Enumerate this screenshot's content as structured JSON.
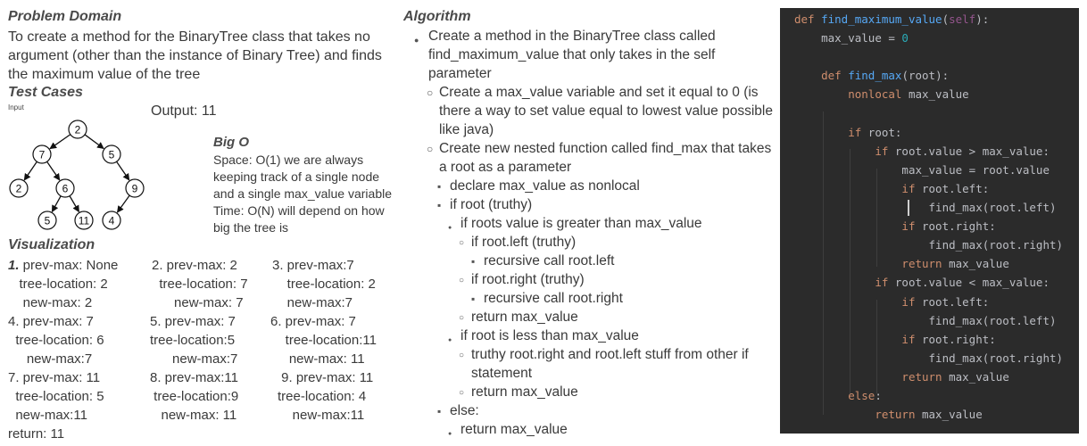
{
  "problem_domain": {
    "heading": "Problem Domain",
    "text": "To create a method for the BinaryTree class that takes no argument (other than the instance of Binary Tree) and finds the maximum value of the tree"
  },
  "test_cases": {
    "heading": "Test Cases",
    "input_label": "Input",
    "output": "Output: 11",
    "tree_nodes": [
      "2",
      "7",
      "5",
      "2",
      "6",
      "9",
      "5",
      "11",
      "4"
    ]
  },
  "big_o": {
    "heading": "Big O",
    "lines": [
      "Space: O(1) we are always",
      "keeping track of a single node",
      "and a single max_value variable",
      "Time: O(N) will depend on how",
      "big the tree is"
    ]
  },
  "visualization": {
    "heading": "Visualization",
    "steps": [
      {
        "num": "1.",
        "a": " prev-max: None",
        "b": "   tree-location: 2",
        "c": "    new-max: 2"
      },
      {
        "a": "2. prev-max: 2",
        "b": "  tree-location: 7",
        "c": "      new-max: 7"
      },
      {
        "a": "3. prev-max:7",
        "b": "    tree-location: 2",
        "c": "    new-max:7"
      },
      {
        "a": "4. prev-max: 7",
        "b": "  tree-location: 6",
        "c": "     new-max:7"
      },
      {
        "a": "5. prev-max: 7",
        "b": "tree-location:5",
        "c": "      new-max:7"
      },
      {
        "a": "6. prev-max: 7",
        "b": "    tree-location:11",
        "c": "     new-max: 11"
      },
      {
        "a": "7. prev-max: 11",
        "b": "  tree-location: 5",
        "c": "  new-max:11"
      },
      {
        "a": "8. prev-max:11",
        "b": " tree-location:9",
        "c": "   new-max: 11"
      },
      {
        "a": " 9. prev-max: 11",
        "b": "tree-location: 4",
        "c": "    new-max:11"
      }
    ],
    "return": "return: 11"
  },
  "algorithm": {
    "heading": "Algorithm",
    "items": [
      "Create a method in the BinaryTree class called find_maximum_value that only takes in the self parameter",
      "Create a max_value variable and set it equal to 0 (is there a way to set value equal to lowest value possible like java)",
      "Create new nested function called find_max that takes a root as a parameter",
      "declare max_value as nonlocal",
      "if root (truthy)",
      "if roots value is greater than max_value",
      "if root.left (truthy)",
      "recursive call root.left",
      "if root.right (truthy)",
      "recursive call root.right",
      "return max_value",
      "if root is less than max_value",
      "truthy root.right and root.left stuff from other if statement",
      "return max_value",
      "else:",
      "return max_value"
    ]
  },
  "code": {
    "colors": {
      "background": "#2b2b2b",
      "keyword": "#cf8e6d",
      "function": "#56a8f5",
      "self": "#94558d",
      "number": "#2aacb8",
      "text": "#bcbec4"
    },
    "lines": [
      {
        "indent": "",
        "parts": [
          [
            "kw",
            "def "
          ],
          [
            "fn",
            "find_maximum_value"
          ],
          [
            "",
            "("
          ],
          [
            "slf",
            "self"
          ],
          [
            "",
            "):"
          ]
        ]
      },
      {
        "indent": "    ",
        "parts": [
          [
            "",
            "max_value = "
          ],
          [
            "num",
            "0"
          ]
        ]
      },
      {
        "indent": "",
        "parts": []
      },
      {
        "indent": "    ",
        "parts": [
          [
            "kw",
            "def "
          ],
          [
            "fn",
            "find_max"
          ],
          [
            "",
            "(root):"
          ]
        ]
      },
      {
        "indent": "        ",
        "parts": [
          [
            "kw",
            "nonlocal "
          ],
          [
            "",
            "max_value"
          ]
        ]
      },
      {
        "indent": "",
        "parts": []
      },
      {
        "indent": "        ",
        "parts": [
          [
            "kw",
            "if "
          ],
          [
            "",
            "root:"
          ]
        ]
      },
      {
        "indent": "            ",
        "parts": [
          [
            "kw",
            "if "
          ],
          [
            "",
            "root.value > max_value:"
          ]
        ]
      },
      {
        "indent": "                ",
        "parts": [
          [
            "",
            "max_value = root.value"
          ]
        ]
      },
      {
        "indent": "                ",
        "parts": [
          [
            "kw",
            "if "
          ],
          [
            "",
            "root.left:"
          ]
        ]
      },
      {
        "indent": "                    ",
        "parts": [
          [
            "",
            "find_max(root.left)"
          ]
        ]
      },
      {
        "indent": "                ",
        "parts": [
          [
            "kw",
            "if "
          ],
          [
            "",
            "root.right:"
          ]
        ]
      },
      {
        "indent": "                    ",
        "parts": [
          [
            "",
            "find_max(root.right)"
          ]
        ]
      },
      {
        "indent": "                ",
        "parts": [
          [
            "kw",
            "return "
          ],
          [
            "",
            "max_value"
          ]
        ]
      },
      {
        "indent": "            ",
        "parts": [
          [
            "kw",
            "if "
          ],
          [
            "",
            "root.value < max_value:"
          ]
        ]
      },
      {
        "indent": "                ",
        "parts": [
          [
            "kw",
            "if "
          ],
          [
            "",
            "root.left:"
          ]
        ]
      },
      {
        "indent": "                    ",
        "parts": [
          [
            "",
            "find_max(root.left)"
          ]
        ]
      },
      {
        "indent": "                ",
        "parts": [
          [
            "kw",
            "if "
          ],
          [
            "",
            "root.right:"
          ]
        ]
      },
      {
        "indent": "                    ",
        "parts": [
          [
            "",
            "find_max(root.right)"
          ]
        ]
      },
      {
        "indent": "                ",
        "parts": [
          [
            "kw",
            "return "
          ],
          [
            "",
            "max_value"
          ]
        ]
      },
      {
        "indent": "        ",
        "parts": [
          [
            "kw",
            "else"
          ],
          [
            "",
            ":"
          ]
        ]
      },
      {
        "indent": "            ",
        "parts": [
          [
            "kw",
            "return "
          ],
          [
            "",
            "max_value"
          ]
        ]
      }
    ]
  }
}
